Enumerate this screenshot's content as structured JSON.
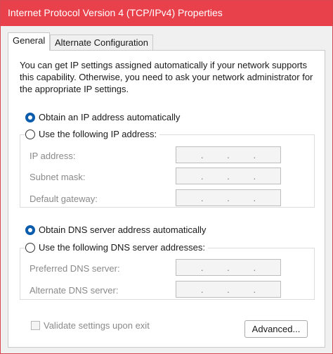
{
  "window": {
    "title": "Internet Protocol Version 4 (TCP/IPv4) Properties",
    "accent_color": "#e8414c"
  },
  "tabs": [
    {
      "label": "General",
      "selected": true
    },
    {
      "label": "Alternate Configuration",
      "selected": false
    }
  ],
  "intro_text": "You can get IP settings assigned automatically if your network supports this capability. Otherwise, you need to ask your network administrator for the appropriate IP settings.",
  "ip_section": {
    "auto_label": "Obtain an IP address automatically",
    "auto_selected": true,
    "manual_label": "Use the following IP address:",
    "manual_selected": false,
    "fields": [
      {
        "label": "IP address:",
        "value": ". . ."
      },
      {
        "label": "Subnet mask:",
        "value": ". . ."
      },
      {
        "label": "Default gateway:",
        "value": ". . ."
      }
    ]
  },
  "dns_section": {
    "auto_label": "Obtain DNS server address automatically",
    "auto_selected": true,
    "manual_label": "Use the following DNS server addresses:",
    "manual_selected": false,
    "fields": [
      {
        "label": "Preferred DNS server:",
        "value": ". . ."
      },
      {
        "label": "Alternate DNS server:",
        "value": ". . ."
      }
    ]
  },
  "validate_label": "Validate settings upon exit",
  "validate_checked": false,
  "advanced_button": "Advanced..."
}
